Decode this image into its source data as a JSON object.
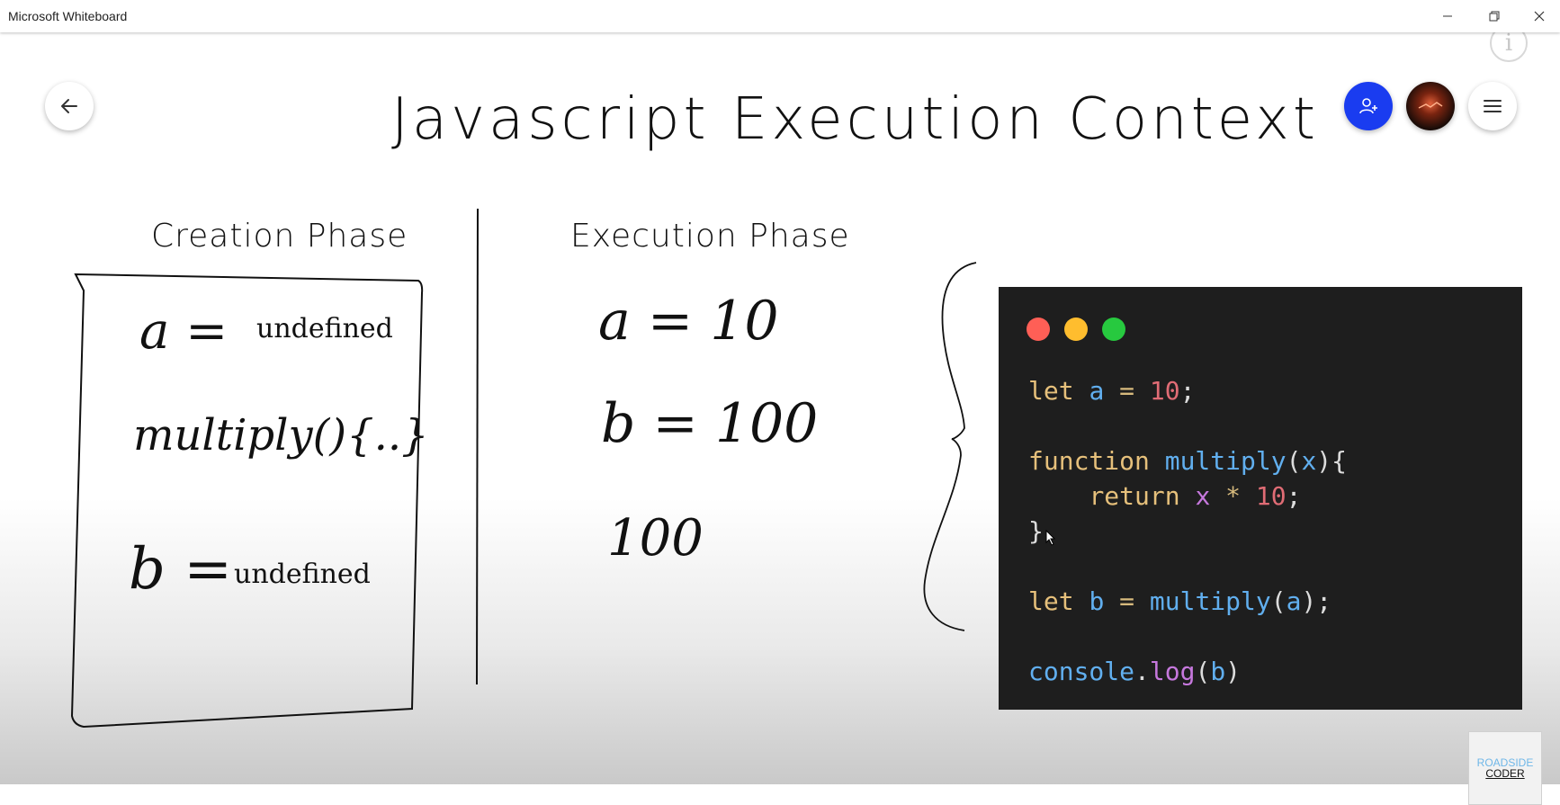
{
  "window": {
    "title": "Microsoft Whiteboard"
  },
  "board": {
    "heading": "Javascript Execution Context",
    "creation": {
      "label": "Creation Phase",
      "a_expr": "a =",
      "a_value": "undefined",
      "multiply_expr": "multiply(){..}",
      "b_expr": "b =",
      "b_value": "undefined"
    },
    "execution": {
      "label": "Execution Phase",
      "a_line": "a = 10",
      "b_line": "b = 100",
      "output": "100"
    }
  },
  "code": {
    "lines": [
      "let a = 10;",
      "",
      "function multiply(x){",
      "    return x * 10;",
      "}",
      "",
      "let b = multiply(a);",
      "",
      "console.log(b)"
    ]
  },
  "toolbar": {
    "back_icon": "arrow-left-icon",
    "invite_icon": "add-person-icon",
    "menu_icon": "hamburger-menu-icon"
  },
  "watermark": {
    "line1": "ROADSIDE",
    "line2": "CODER"
  },
  "colors": {
    "invite_button": "#1a3cf0",
    "code_background": "#1e1e1e",
    "dot_red": "#ff5f56",
    "dot_yellow": "#ffbd2e",
    "dot_green": "#27c93f"
  }
}
